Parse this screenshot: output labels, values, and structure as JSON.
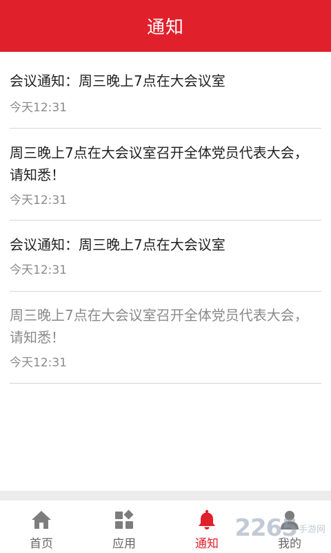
{
  "header": {
    "title": "通知"
  },
  "notifications": [
    {
      "title": "会议通知：周三晚上7点在大会议室",
      "time": "今天12:31",
      "read": false
    },
    {
      "title": "周三晚上7点在大会议室召开全体党员代表大会，请知悉！",
      "time": "今天12:31",
      "read": false
    },
    {
      "title": "会议通知：周三晚上7点在大会议室",
      "time": "今天12:31",
      "read": false
    },
    {
      "title": "周三晚上7点在大会议室召开全体党员代表大会，请知悉！",
      "time": "今天12:31",
      "read": true
    }
  ],
  "tabbar": {
    "tabs": [
      {
        "label": "首页",
        "icon": "home-icon",
        "active": false
      },
      {
        "label": "应用",
        "icon": "apps-icon",
        "active": false
      },
      {
        "label": "通知",
        "icon": "bell-icon",
        "active": true
      },
      {
        "label": "我的",
        "icon": "user-icon",
        "active": false
      }
    ]
  },
  "watermark": {
    "number": "2265",
    "text": "手游网"
  },
  "colors": {
    "accent": "#e0202b",
    "inactive": "#666666",
    "icon_inactive": "#7d7d7d"
  }
}
